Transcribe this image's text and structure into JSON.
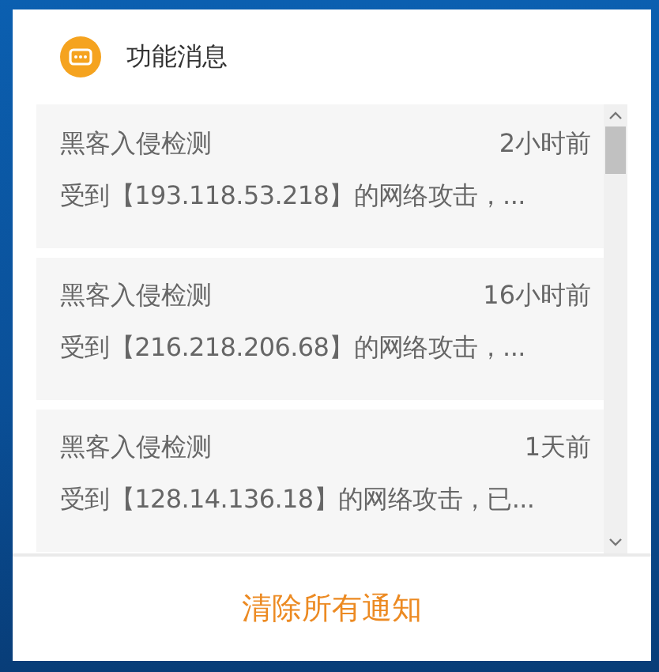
{
  "header": {
    "title": "功能消息"
  },
  "notifications": [
    {
      "title": "黑客入侵检测",
      "time": "2小时前",
      "message": "受到【193.118.53.218】的网络攻击，..."
    },
    {
      "title": "黑客入侵检测",
      "time": "16小时前",
      "message": "受到【216.218.206.68】的网络攻击，..."
    },
    {
      "title": "黑客入侵检测",
      "time": "1天前",
      "message": "受到【128.14.136.18】的网络攻击，已..."
    }
  ],
  "footer": {
    "button": "清除所有通知"
  }
}
